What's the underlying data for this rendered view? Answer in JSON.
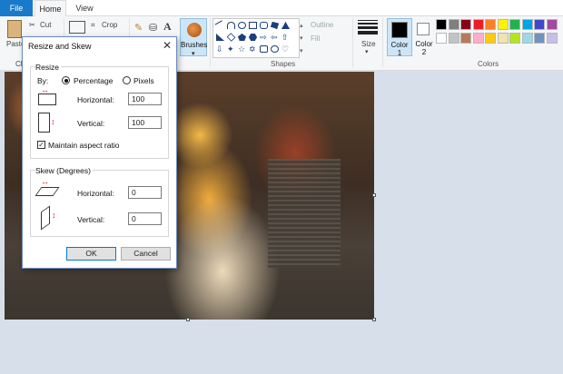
{
  "tabs": {
    "file": "File",
    "home": "Home",
    "view": "View"
  },
  "ribbon": {
    "paste": "Paste",
    "cut": "Cut",
    "crop": "Crop",
    "clip": "Cl",
    "brushes": "Brushes",
    "outline": "Outline",
    "fill": "Fill",
    "shapes": "Shapes",
    "size": "Size",
    "color1": "Color\n1",
    "color1_a": "Color",
    "color1_b": "1",
    "color2_a": "Color",
    "color2_b": "2",
    "colors": "Colors"
  },
  "palette": {
    "row1": [
      "#000000",
      "#7f7f7f",
      "#880015",
      "#ed1c24",
      "#ff7f27",
      "#fff200",
      "#22b14c",
      "#00a2e8",
      "#3f48cc",
      "#a349a4"
    ],
    "row2": [
      "#ffffff",
      "#c3c3c3",
      "#b97a57",
      "#ffaec9",
      "#ffc90e",
      "#efe4b0",
      "#b5e61d",
      "#99d9ea",
      "#7092be",
      "#c8bfe7"
    ]
  },
  "dialog": {
    "title": "Resize and Skew",
    "close_glyph": "✕",
    "resize": {
      "label": "Resize",
      "by": "By:",
      "percentage": "Percentage",
      "pixels": "Pixels",
      "horizontal_label": "Horizontal:",
      "horizontal_value": "100",
      "vertical_label": "Vertical:",
      "vertical_value": "100",
      "maintain_aspect": "Maintain aspect ratio"
    },
    "skew": {
      "label": "Skew (Degrees)",
      "horizontal_label": "Horizontal:",
      "horizontal_value": "0",
      "vertical_label": "Vertical:",
      "vertical_value": "0"
    },
    "ok": "OK",
    "cancel": "Cancel"
  }
}
